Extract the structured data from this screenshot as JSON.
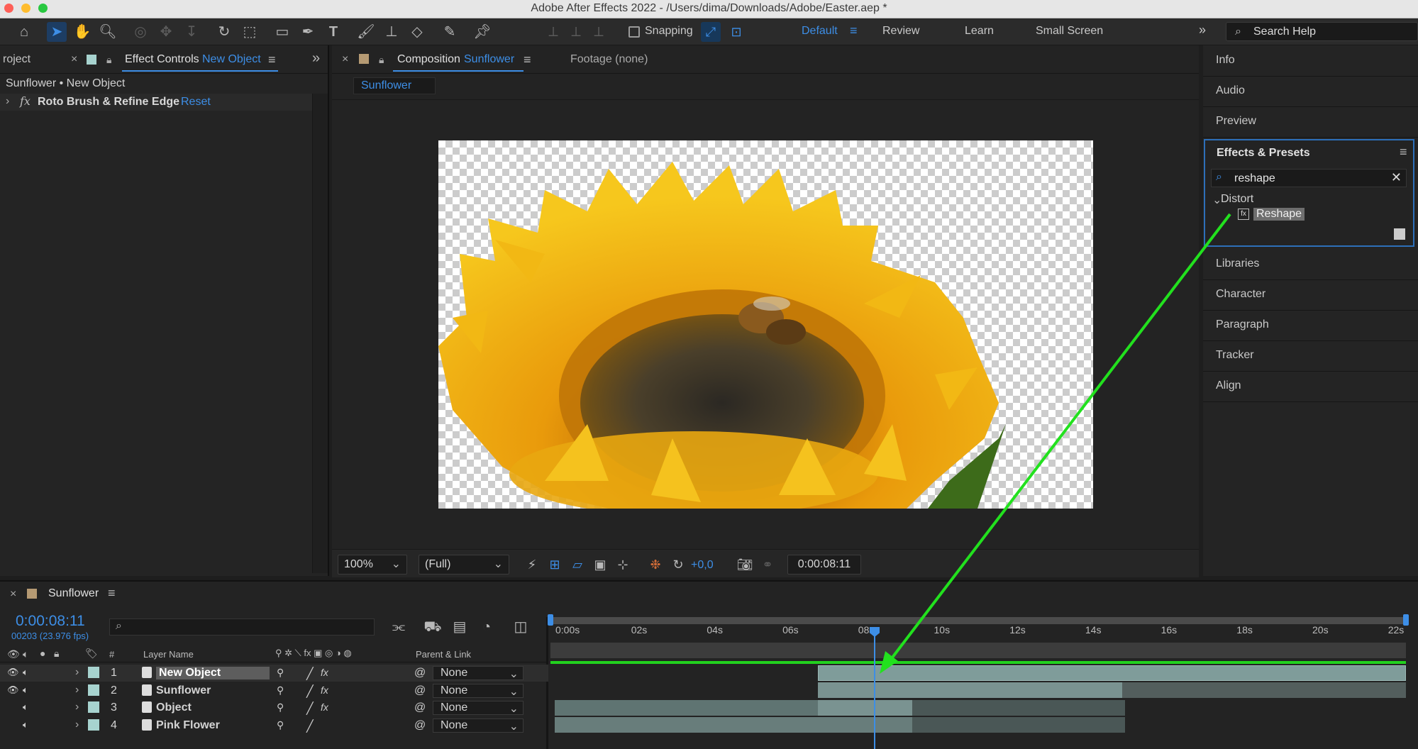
{
  "window": {
    "title": "Adobe After Effects 2022 - /Users/dima/Downloads/Adobe/Easter.aep *"
  },
  "toolbar": {
    "snapping_label": "Snapping",
    "workspaces": [
      "Default",
      "Review",
      "Learn",
      "Small Screen"
    ],
    "search_placeholder": "Search Help"
  },
  "effect_controls": {
    "tab_project": "roject",
    "tab_label": "Effect Controls",
    "tab_target": "New Object",
    "subtitle": "Sunflower • New Object",
    "effect_name": "Roto Brush & Refine Edge",
    "reset_label": "Reset"
  },
  "composition": {
    "tab_label": "Composition",
    "tab_target": "Sunflower",
    "footage_tab": "Footage (none)",
    "comp_chip": "Sunflower",
    "zoom": "100%",
    "resolution": "(Full)",
    "exposure": "+0,0",
    "timecode": "0:00:08:11"
  },
  "right_panel": {
    "items_top": [
      "Info",
      "Audio",
      "Preview"
    ],
    "effects_presets_title": "Effects & Presets",
    "search_value": "reshape",
    "category": "Distort",
    "result": "Reshape",
    "items_bottom": [
      "Libraries",
      "Character",
      "Paragraph",
      "Tracker",
      "Align"
    ]
  },
  "timeline": {
    "tab_label": "Sunflower",
    "current_time": "0:00:08:11",
    "frame_info": "00203 (23.976 fps)",
    "col_hash": "#",
    "col_layer_name": "Layer Name",
    "col_parent": "Parent & Link",
    "ruler": [
      "0:00s",
      "02s",
      "04s",
      "06s",
      "08s",
      "10s",
      "12s",
      "14s",
      "16s",
      "18s",
      "20s",
      "22s"
    ],
    "layers": [
      {
        "num": "1",
        "name": "New Object",
        "parent": "None",
        "fx": true,
        "eye": true
      },
      {
        "num": "2",
        "name": "Sunflower",
        "parent": "None",
        "fx": true,
        "eye": true
      },
      {
        "num": "3",
        "name": "Object",
        "parent": "None",
        "fx": true,
        "eye": false
      },
      {
        "num": "4",
        "name": "Pink Flower",
        "parent": "None",
        "fx": false,
        "eye": false
      }
    ]
  },
  "colors": {
    "accent": "#3d8ee6",
    "arrow": "#22e11e",
    "panel_bg": "#232323",
    "layer_label": "#a7d3cf"
  }
}
